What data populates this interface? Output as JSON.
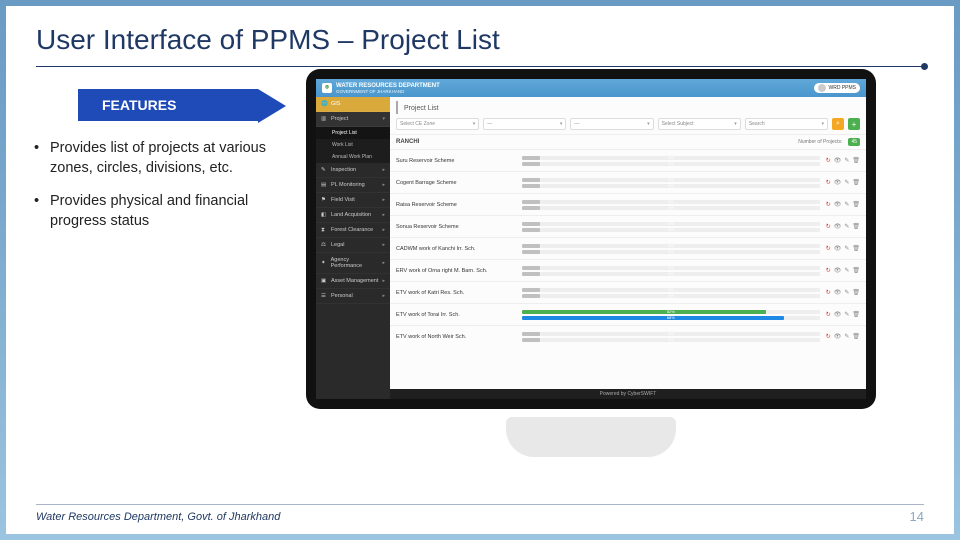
{
  "title": "User Interface of PPMS – Project List",
  "features_label": "FEATURES",
  "bullets": [
    "Provides list of projects at various zones, circles, divisions, etc.",
    "Provides physical and financial progress status"
  ],
  "footer": {
    "dept": "Water Resources Department, Govt. of Jharkhand",
    "page": "14"
  },
  "app": {
    "header": {
      "dept": "WATER RESOURCES DEPARTMENT",
      "sub": "GOVERNMENT OF JHARKHAND",
      "user": "WRD PPMS"
    },
    "sidebar": {
      "gis": "GIS",
      "menu": [
        {
          "label": "Project",
          "expanded": true,
          "subs": [
            "Project List",
            "Work List",
            "Annual Work Plan"
          ]
        },
        {
          "label": "Inspection"
        },
        {
          "label": "PL Monitoring"
        },
        {
          "label": "Field Visit"
        },
        {
          "label": "Land Acquisition"
        },
        {
          "label": "Forest Clearance"
        },
        {
          "label": "Legal"
        },
        {
          "label": "Agency Performance"
        },
        {
          "label": "Asset Management"
        },
        {
          "label": "Personal"
        }
      ]
    },
    "page_title": "Project List",
    "filters": {
      "zone": "Select CE Zone",
      "sub1": "—",
      "sub2": "—",
      "sub3": "Select Subject",
      "search": "Search"
    },
    "zone": {
      "name": "RANCHI",
      "np_label": "Number of Projects:",
      "count": "45"
    },
    "rows": [
      {
        "name": "Suru Reservoir Scheme",
        "p": 0,
        "f": 0,
        "c1": "#c0c0c0",
        "c2": "#c0c0c0"
      },
      {
        "name": "Cogent Barrage Scheme",
        "p": 0,
        "f": 0,
        "c1": "#c0c0c0",
        "c2": "#c0c0c0"
      },
      {
        "name": "Raisa Reservoir Scheme",
        "p": 0,
        "f": 0,
        "c1": "#c0c0c0",
        "c2": "#c0c0c0"
      },
      {
        "name": "Sonua Reservoir Scheme",
        "p": 0,
        "f": 0,
        "c1": "#c0c0c0",
        "c2": "#c0c0c0"
      },
      {
        "name": "CADWM work of Kanchi Irr. Sch.",
        "p": 0,
        "f": 0,
        "c1": "#c0c0c0",
        "c2": "#c0c0c0"
      },
      {
        "name": "ERV work of Orna right M. Barn. Sch.",
        "p": 0,
        "f": 0,
        "c1": "#c0c0c0",
        "c2": "#c0c0c0"
      },
      {
        "name": "ETV work of Katri Res. Sch.",
        "p": 0,
        "f": 0,
        "c1": "#c0c0c0",
        "c2": "#c0c0c0"
      },
      {
        "name": "ETV work of Torai Irr. Sch.",
        "p": 82,
        "f": 88,
        "c1": "#4caf50",
        "c2": "#1e88e5"
      },
      {
        "name": "ETV work of North Weir Sch.",
        "p": 0,
        "f": 0,
        "c1": "#c0c0c0",
        "c2": "#c0c0c0"
      }
    ],
    "footer_text": "Powered by CyberSWIFT"
  }
}
